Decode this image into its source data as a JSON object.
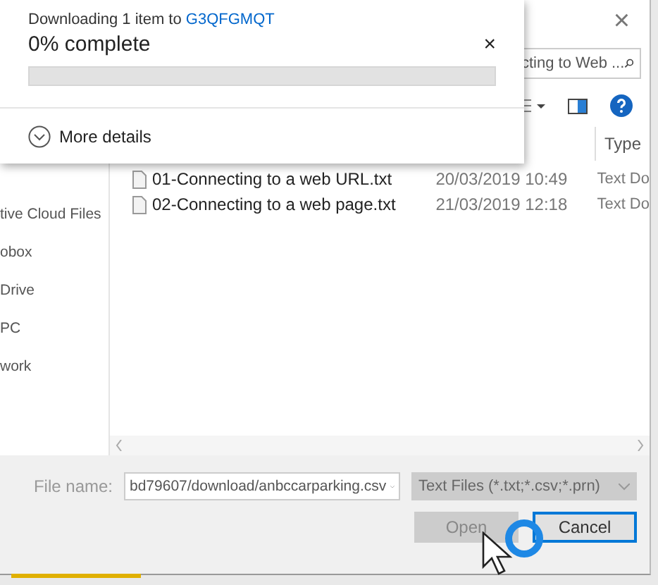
{
  "download_popup": {
    "message": "Downloading 1 item to",
    "link": "G3QFGMQT",
    "status": "0% complete",
    "close": "×",
    "level": 0,
    "details": "More details"
  },
  "dialog": {
    "close": "×",
    "search": {
      "value": "cting to Web ..."
    },
    "columns": [
      {
        "label": "Type"
      }
    ],
    "nav": [
      "tive Cloud Files",
      "obox",
      "Drive",
      "PC",
      "work"
    ],
    "files": [
      {
        "name": "01-Connecting to a web URL.txt",
        "date": "20/03/2019 10:49",
        "type": "Text Do"
      },
      {
        "name": "02-Connecting to a web page.txt",
        "date": "21/03/2019 12:18",
        "type": "Text Do"
      }
    ],
    "file_name_label": "File name:",
    "file_name": "bd79607/download/anbccarparking.csv",
    "file_type": "Text Files (*.txt;*.csv;*.prn)",
    "buttons": [
      {
        "label": "Open",
        "disabled": true
      },
      {
        "label": "Cancel",
        "disabled": false
      }
    ]
  }
}
